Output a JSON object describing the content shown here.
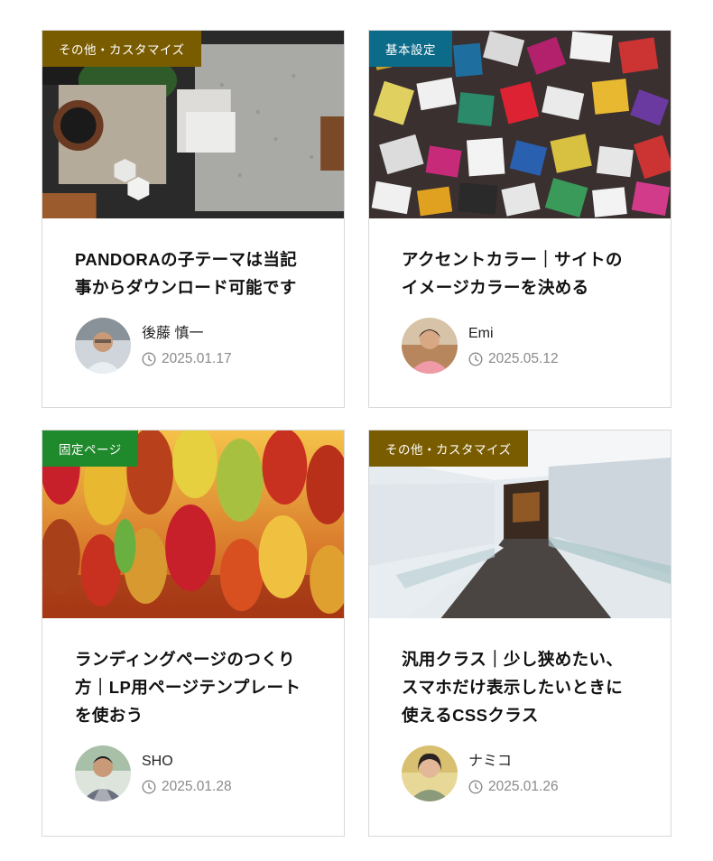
{
  "posts": [
    {
      "category": "その他・カスタマイズ",
      "category_color": "#7a5c00",
      "title_lines": [
        "PANDORAの子テーマは当記",
        "事からダウンロード可能です"
      ],
      "author": "後藤 慎一",
      "date": "2025.01.17",
      "image": "material-samples-photo"
    },
    {
      "category": "基本設定",
      "category_color": "#0d6b8a",
      "title_lines": [
        "アクセントカラー｜サイトの",
        "イメージカラーを決める"
      ],
      "author": "Emi",
      "date": "2025.05.12",
      "image": "magazine-letters-collage-photo"
    },
    {
      "category": "固定ページ",
      "category_color": "#1f8a2c",
      "title_lines": [
        "ランディングページのつくり",
        "方｜LP用ページテンプレート",
        "を使おう"
      ],
      "author": "SHO",
      "date": "2025.01.28",
      "image": "paper-umbrellas-photo"
    },
    {
      "category": "その他・カスタマイズ",
      "category_color": "#7a5c00",
      "title_lines": [
        "汎用クラス｜少し狭めたい、",
        "スマホだけ表示したいときに",
        "使えるCSSクラス"
      ],
      "author": "ナミコ",
      "date": "2025.01.26",
      "image": "white-corridor-photo"
    }
  ],
  "icons": {
    "date": "clock-icon"
  }
}
